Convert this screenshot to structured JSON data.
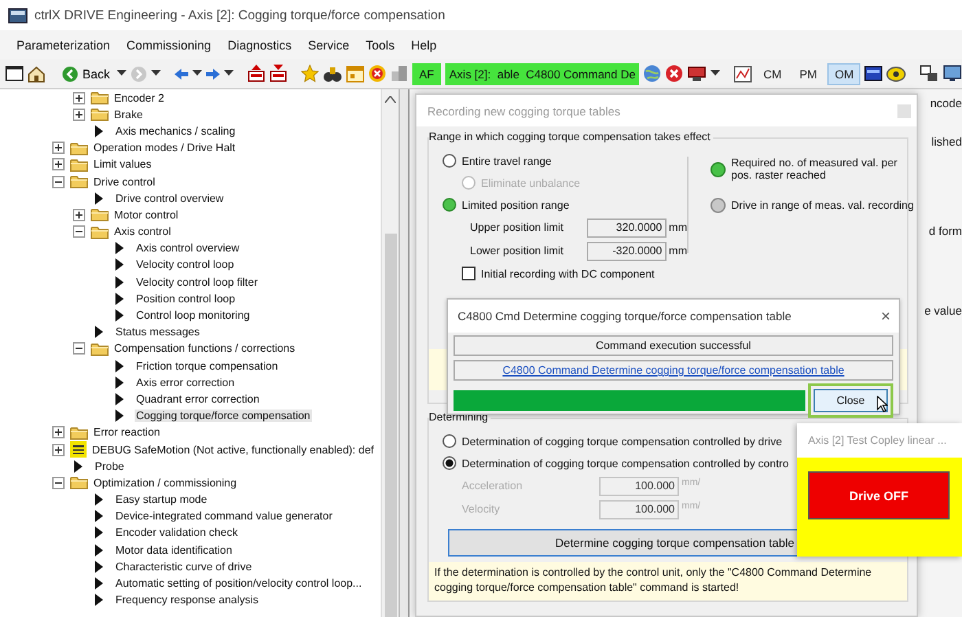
{
  "window": {
    "title": "ctrlX DRIVE Engineering - Axis [2]: Cogging torque/force compensation"
  },
  "menu": [
    "Parameterization",
    "Commissioning",
    "Diagnostics",
    "Service",
    "Tools",
    "Help"
  ],
  "toolbar": {
    "back": "Back",
    "af": "AF",
    "axis_status": "Axis [2]:  able  C4800 Command De",
    "modes": [
      {
        "label": "CM",
        "selected": false
      },
      {
        "label": "PM",
        "selected": false
      },
      {
        "label": "OM",
        "selected": true
      }
    ]
  },
  "tree": {
    "continued": [
      {
        "label": "Encoder 2",
        "kind": "folder",
        "expanded": false,
        "selected": false
      },
      {
        "label": "Brake",
        "kind": "folder",
        "expanded": false,
        "selected": false
      },
      {
        "label": "Axis mechanics / scaling",
        "kind": "page",
        "selected": false
      }
    ],
    "items": [
      {
        "label": "Operation modes / Drive Halt",
        "kind": "folder",
        "expanded": false,
        "selected": false
      },
      {
        "label": "Limit values",
        "kind": "folder",
        "expanded": false,
        "selected": false
      },
      {
        "label": "Drive control",
        "kind": "folder",
        "expanded": true,
        "selected": false,
        "children": [
          {
            "label": "Drive control overview",
            "kind": "page",
            "selected": false
          },
          {
            "label": "Motor control",
            "kind": "folder",
            "expanded": false,
            "selected": false
          },
          {
            "label": "Axis control",
            "kind": "folder",
            "expanded": true,
            "selected": false,
            "children": [
              {
                "label": "Axis control overview",
                "kind": "page",
                "selected": false
              },
              {
                "label": "Velocity control loop",
                "kind": "page",
                "selected": false
              },
              {
                "label": "Velocity control loop filter",
                "kind": "page",
                "selected": false
              },
              {
                "label": "Position control loop",
                "kind": "page",
                "selected": false
              },
              {
                "label": "Control loop monitoring",
                "kind": "page",
                "selected": false
              }
            ]
          },
          {
            "label": "Status messages",
            "kind": "page",
            "selected": false
          },
          {
            "label": "Compensation functions / corrections",
            "kind": "folder",
            "expanded": true,
            "selected": false,
            "children": [
              {
                "label": "Friction torque compensation",
                "kind": "page",
                "selected": false
              },
              {
                "label": "Axis error correction",
                "kind": "page",
                "selected": false
              },
              {
                "label": "Quadrant error correction",
                "kind": "page",
                "selected": false
              },
              {
                "label": "Cogging torque/force compensation",
                "kind": "page",
                "selected": true
              }
            ]
          }
        ]
      },
      {
        "label": "Error reaction",
        "kind": "folder",
        "expanded": false,
        "selected": false
      },
      {
        "label": "DEBUG SafeMotion (Not active, functionally enabled): def",
        "kind": "safety",
        "expanded": false,
        "selected": false
      },
      {
        "label": "Probe",
        "kind": "page",
        "selected": false
      },
      {
        "label": "Optimization / commissioning",
        "kind": "folder",
        "expanded": true,
        "selected": false,
        "children": [
          {
            "label": "Easy startup mode",
            "kind": "page",
            "selected": false
          },
          {
            "label": "Device-integrated command value generator",
            "kind": "page",
            "selected": false
          },
          {
            "label": "Encoder validation check",
            "kind": "page",
            "selected": false
          },
          {
            "label": "Motor data identification",
            "kind": "page",
            "selected": false
          },
          {
            "label": "Characteristic curve of drive",
            "kind": "page",
            "selected": false
          },
          {
            "label": "Automatic setting of position/velocity control loop...",
            "kind": "page",
            "selected": false
          },
          {
            "label": "Frequency response analysis",
            "kind": "page",
            "selected": false
          }
        ]
      }
    ]
  },
  "behind": [
    "ncode",
    "lished",
    "d form",
    "e value"
  ],
  "dialog": {
    "title": "Recording new cogging torque tables",
    "range_group": {
      "title": "Range in which cogging torque compensation takes effect",
      "options": [
        {
          "label": "Entire travel range",
          "selected": false,
          "disabled": false,
          "indent": false
        },
        {
          "label": "Eliminate unbalance",
          "selected": false,
          "disabled": true,
          "indent": true
        },
        {
          "label": "Limited position range",
          "selected": true,
          "disabled": false,
          "indent": false
        }
      ],
      "indicators": [
        {
          "label": "Required no. of measured val. per pos. raster reached",
          "on": true
        },
        {
          "label": "Drive in range of meas. val. recording",
          "on": false
        }
      ],
      "fields": [
        {
          "label": "Upper position limit",
          "value": "320.0000",
          "unit": "mm"
        },
        {
          "label": "Lower position limit",
          "value": "-320.0000",
          "unit": "mm"
        }
      ],
      "checkbox": {
        "label": "Initial recording with DC component",
        "checked": false
      }
    },
    "determining": {
      "title": "Determining",
      "options": [
        {
          "label": "Determination of cogging torque compensation controlled by drive",
          "selected": false
        },
        {
          "label": "Determination of cogging torque compensation controlled by contro",
          "selected": true
        }
      ],
      "fields": [
        {
          "label": "Acceleration",
          "value": "100.000",
          "unit": "mm/",
          "disabled": true
        },
        {
          "label": "Velocity",
          "value": "100.000",
          "unit": "mm/",
          "disabled": true
        }
      ],
      "button": "Determine cogging torque compensation table",
      "note": "If the determination is controlled by the control unit, only the \"C4800 Command Determine cogging torque/force compensation table\" command is started!"
    }
  },
  "command_popup": {
    "title": "C4800 Cmd Determine cogging torque/force compensation table",
    "close_icon": "×",
    "status": "Command execution successful",
    "link": "C4800 Command Determine cogging torque/force compensation table",
    "progress": {
      "level": 1
    },
    "button": "Close"
  },
  "drive_popup": {
    "title": "Axis [2] Test Copley linear ...",
    "button": "Drive OFF"
  }
}
